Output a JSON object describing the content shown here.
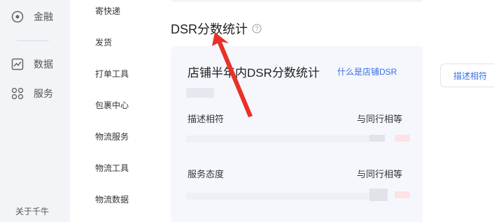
{
  "rail": {
    "items": [
      {
        "label": "金融",
        "icon": "circle-dot-icon"
      },
      {
        "label": "数据",
        "icon": "chart-line-icon"
      },
      {
        "label": "服务",
        "icon": "grid-circles-icon"
      }
    ],
    "footer": "关于千牛"
  },
  "subnav": {
    "items": [
      "寄快递",
      "发货",
      "打单工具",
      "包裹中心",
      "物流服务",
      "物流工具",
      "物流数据"
    ]
  },
  "section": {
    "title": "DSR分数统计",
    "help_icon": "question-circle-icon"
  },
  "card": {
    "title": "店铺半年内DSR分数统计",
    "link": "什么是店铺DSR",
    "rows": [
      {
        "label": "描述相符",
        "compare": "与同行相等"
      },
      {
        "label": "服务态度",
        "compare": "与同行相等"
      }
    ]
  },
  "right_panel": {
    "tab": "描述相符"
  },
  "colors": {
    "accent": "#3a6fe0",
    "arrow": "#e8312a",
    "rail_bg": "#f3f4f8",
    "card_bg": "#f5f7fc"
  }
}
